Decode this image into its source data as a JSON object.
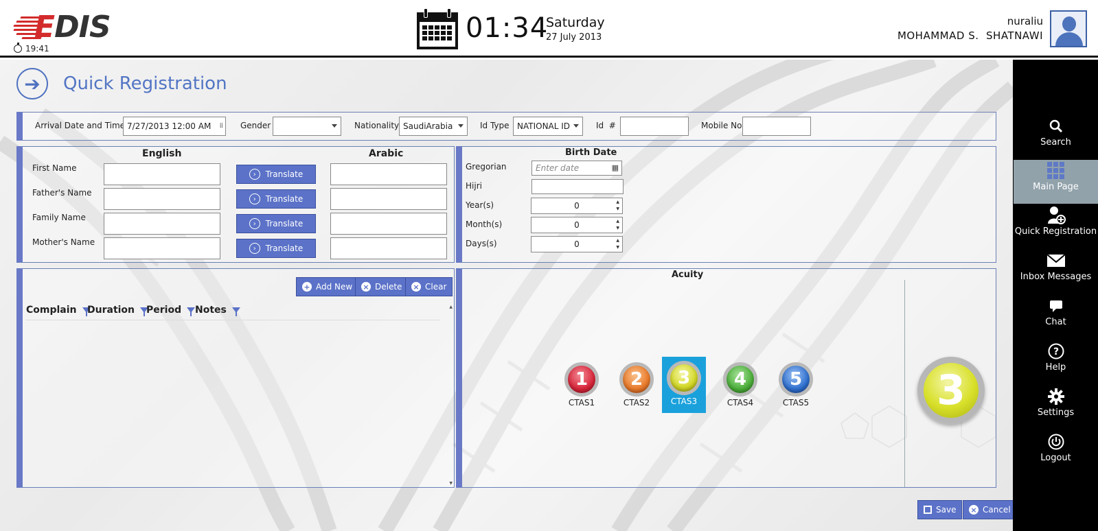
{
  "header": {
    "logo_text": "EDIS",
    "small_time": "19:41",
    "time": "01:34",
    "day": "Saturday",
    "date": "27 July 2013",
    "username": "nuraliu",
    "fullname": "MOHAMMAD S.  SHATNAWI"
  },
  "page": {
    "title": "Quick Registration"
  },
  "top_fields": {
    "arrival_label": "Arrival Date and Time",
    "arrival_value": "7/27/2013 12:00 AM",
    "gender_label": "Gender",
    "gender_value": "",
    "nationality_label": "Nationality",
    "nationality_value": "SaudiArabia",
    "id_type_label": "Id Type",
    "id_type_value": "NATIONAL ID",
    "id_no_label": "Id  #",
    "mobile_label": "Mobile No"
  },
  "names": {
    "english_head": "English",
    "arabic_head": "Arabic",
    "rows": [
      {
        "label": "First Name"
      },
      {
        "label": "Father's Name"
      },
      {
        "label": "Family Name"
      },
      {
        "label": "Mother's Name"
      }
    ],
    "translate_label": "Translate"
  },
  "birth": {
    "title": "Birth Date",
    "gregorian_label": "Gregorian",
    "gregorian_placeholder": "Enter date",
    "hijri_label": "Hijri",
    "years_label": "Year(s)",
    "years_value": "0",
    "months_label": "Month(s)",
    "months_value": "0",
    "days_label": "Days(s)",
    "days_value": "0"
  },
  "complaints": {
    "add_label": "Add New",
    "delete_label": "Delete",
    "clear_label": "Clear",
    "columns": [
      "Complain",
      "Duration",
      "Period",
      "Notes"
    ]
  },
  "acuity": {
    "title": "Acuity",
    "levels": [
      {
        "num": "1",
        "label": "CTAS1",
        "color": "#d8263a"
      },
      {
        "num": "2",
        "label": "CTAS2",
        "color": "#ea7a2a"
      },
      {
        "num": "3",
        "label": "CTAS3",
        "color": "#d3d825"
      },
      {
        "num": "4",
        "label": "CTAS4",
        "color": "#4caf3a"
      },
      {
        "num": "5",
        "label": "CTAS5",
        "color": "#2f70d0"
      }
    ],
    "selected": "3"
  },
  "footer": {
    "save_label": "Save",
    "cancel_label": "Cancel"
  },
  "sidebar": {
    "items": [
      {
        "label": "Search",
        "icon": "search-icon"
      },
      {
        "label": "Main Page",
        "icon": "grid-icon"
      },
      {
        "label": "Quick Registration",
        "icon": "add-user-icon"
      },
      {
        "label": "Inbox Messages",
        "icon": "mail-icon"
      },
      {
        "label": "Chat",
        "icon": "chat-icon"
      },
      {
        "label": "Help",
        "icon": "help-icon"
      },
      {
        "label": "Settings",
        "icon": "gear-icon"
      },
      {
        "label": "Logout",
        "icon": "power-icon"
      }
    ],
    "active": "Main Page"
  }
}
